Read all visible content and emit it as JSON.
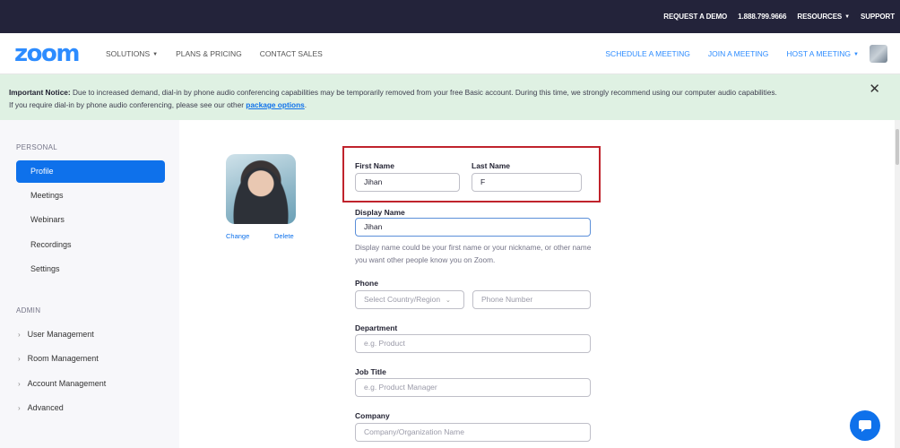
{
  "topbar": {
    "request_demo": "REQUEST A DEMO",
    "phone": "1.888.799.9666",
    "resources": "RESOURCES",
    "support": "SUPPORT"
  },
  "header": {
    "logo": "zoom",
    "nav_left": [
      "SOLUTIONS",
      "PLANS & PRICING",
      "CONTACT SALES"
    ],
    "schedule": "SCHEDULE A MEETING",
    "join": "JOIN A MEETING",
    "host": "HOST A MEETING"
  },
  "notice": {
    "bold": "Important Notice:",
    "text": " Due to increased demand, dial-in by phone audio conferencing capabilities may be temporarily removed from your free Basic account. During this time, we strongly recommend using our computer audio capabilities.",
    "text2": "If you require dial-in by phone audio conferencing, please see our other ",
    "link": "package options",
    "end": ".",
    "close": "✕"
  },
  "sidebar": {
    "personal_label": "PERSONAL",
    "personal": [
      "Profile",
      "Meetings",
      "Webinars",
      "Recordings",
      "Settings"
    ],
    "admin_label": "ADMIN",
    "admin": [
      "User Management",
      "Room Management",
      "Account Management",
      "Advanced"
    ]
  },
  "profile": {
    "change": "Change",
    "delete": "Delete"
  },
  "form": {
    "first_name_label": "First Name",
    "first_name_value": "Jihan",
    "last_name_label": "Last Name",
    "last_name_value": "F",
    "display_name_label": "Display Name",
    "display_name_value": "Jihan",
    "display_help": "Display name could be your first name or your nickname, or other name you want other people know you on Zoom.",
    "phone_label": "Phone",
    "country_placeholder": "Select Country/Region",
    "phone_placeholder": "Phone Number",
    "department_label": "Department",
    "department_placeholder": "e.g. Product",
    "job_label": "Job Title",
    "job_placeholder": "e.g. Product Manager",
    "company_label": "Company",
    "company_placeholder": "Company/Organization Name"
  },
  "colors": {
    "brand": "#2d8cff",
    "active": "#0e71eb",
    "highlight_border": "#c0232c",
    "notice_bg": "#dff1e3",
    "topbar_bg": "#23233a"
  }
}
